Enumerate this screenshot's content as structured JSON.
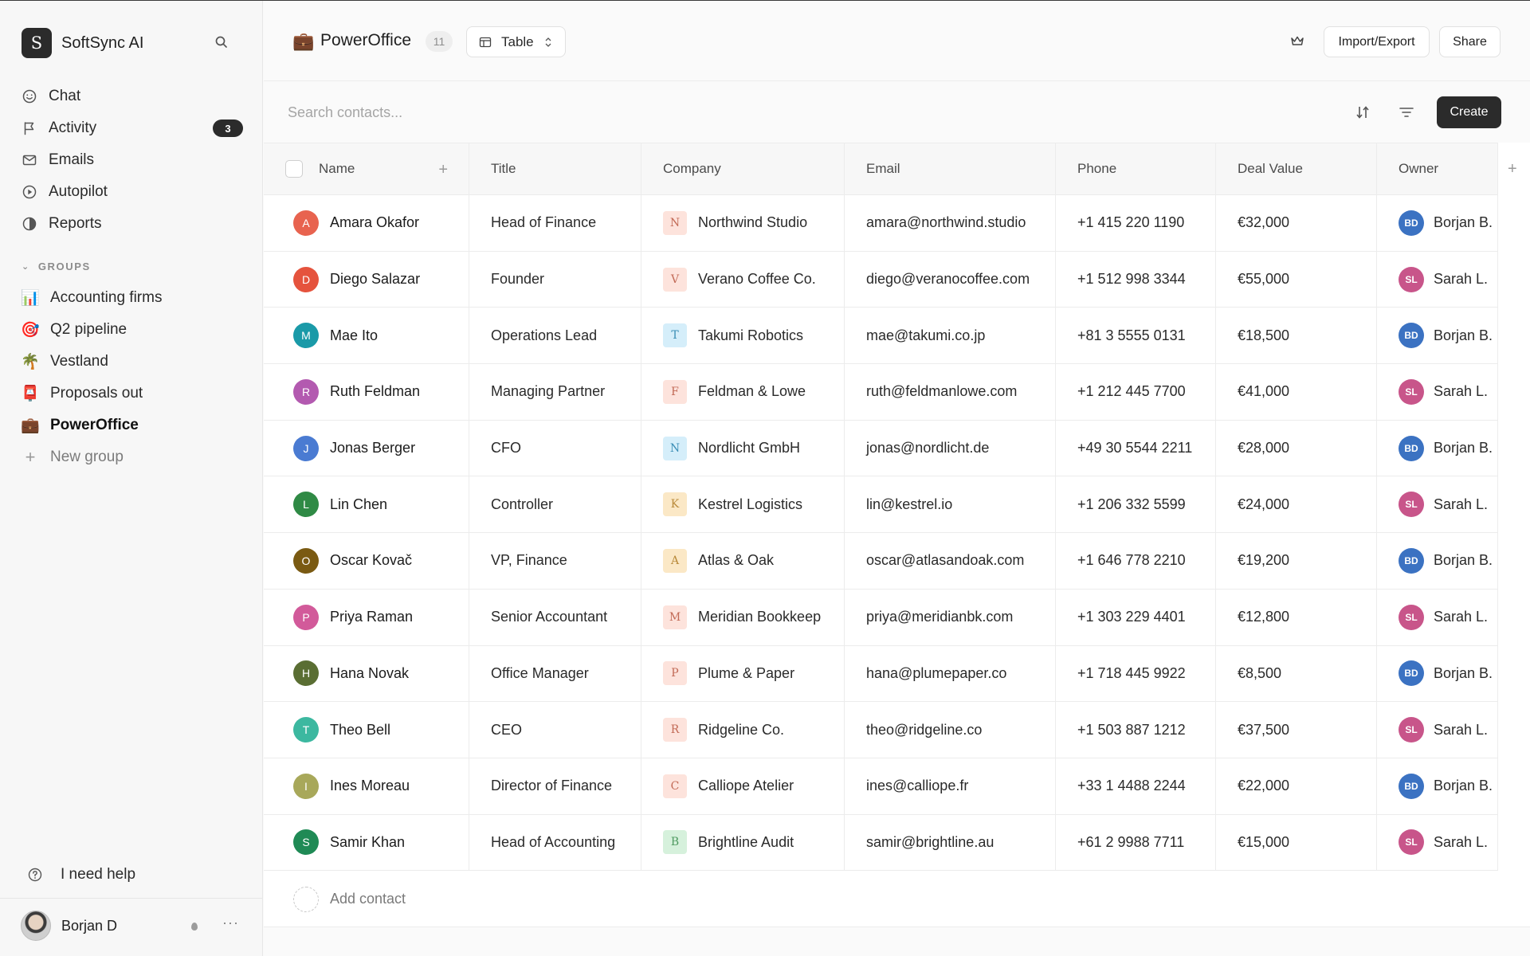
{
  "app": {
    "name": "SoftSync AI",
    "logo_letter": "S"
  },
  "sidebar": {
    "nav": [
      {
        "id": "chat",
        "label": "Chat",
        "icon": "smile-icon"
      },
      {
        "id": "activity",
        "label": "Activity",
        "icon": "flag-icon",
        "badge": "3"
      },
      {
        "id": "emails",
        "label": "Emails",
        "icon": "mail-icon"
      },
      {
        "id": "autopilot",
        "label": "Autopilot",
        "icon": "play-circle-icon"
      },
      {
        "id": "reports",
        "label": "Reports",
        "icon": "half-circle-icon"
      }
    ],
    "groups_heading": "GROUPS",
    "groups": [
      {
        "label": "Accounting firms",
        "emoji": "📊"
      },
      {
        "label": "Q2 pipeline",
        "emoji": "🎯"
      },
      {
        "label": "Vestland",
        "emoji": "🌴"
      },
      {
        "label": "Proposals out",
        "emoji": "📮"
      },
      {
        "label": "PowerOffice",
        "emoji": "💼",
        "active": true
      }
    ],
    "new_group_label": "New group",
    "help_label": "I need help",
    "user_name": "Borjan D",
    "more_label": "···"
  },
  "header": {
    "title": "PowerOffice",
    "emoji": "💼",
    "count": "11",
    "view_label": "Table",
    "import_export_label": "Import/Export",
    "share_label": "Share"
  },
  "toolbar": {
    "search_placeholder": "Search contacts...",
    "create_label": "Create"
  },
  "table": {
    "columns": [
      "Name",
      "Title",
      "Company",
      "Email",
      "Phone",
      "Deal Value",
      "Owner"
    ],
    "add_contact_label": "Add contact",
    "rows": [
      {
        "initial": "A",
        "avatar_color": "#e8634f",
        "name": "Amara Okafor",
        "title": "Head of Finance",
        "company": "Northwind Studio",
        "co_letter": "N",
        "co_bg": "#fde3dc",
        "co_fg": "#c26a56",
        "email": "amara@northwind.studio",
        "phone": "+1 415 220 1190",
        "deal": "€32,000",
        "owner_initials": "BD",
        "owner_color": "#3b72c2",
        "owner": "Borjan B."
      },
      {
        "initial": "D",
        "avatar_color": "#e5533d",
        "name": "Diego Salazar",
        "title": "Founder",
        "company": "Verano Coffee Co.",
        "co_letter": "V",
        "co_bg": "#fde3dc",
        "co_fg": "#c26a56",
        "email": "diego@veranocoffee.com",
        "phone": "+1 512 998 3344",
        "deal": "€55,000",
        "owner_initials": "SL",
        "owner_color": "#c8558a",
        "owner": "Sarah L."
      },
      {
        "initial": "M",
        "avatar_color": "#1a9aa8",
        "name": "Mae Ito",
        "title": "Operations Lead",
        "company": "Takumi Robotics",
        "co_letter": "T",
        "co_bg": "#d5eefa",
        "co_fg": "#3c8fb6",
        "email": "mae@takumi.co.jp",
        "phone": "+81 3 5555 0131",
        "deal": "€18,500",
        "owner_initials": "BD",
        "owner_color": "#3b72c2",
        "owner": "Borjan B."
      },
      {
        "initial": "R",
        "avatar_color": "#b35ab0",
        "name": "Ruth Feldman",
        "title": "Managing Partner",
        "company": "Feldman & Lowe",
        "co_letter": "F",
        "co_bg": "#fde3dc",
        "co_fg": "#c26a56",
        "email": "ruth@feldmanlowe.com",
        "phone": "+1 212 445 7700",
        "deal": "€41,000",
        "owner_initials": "SL",
        "owner_color": "#c8558a",
        "owner": "Sarah L."
      },
      {
        "initial": "J",
        "avatar_color": "#4a7bd2",
        "name": "Jonas Berger",
        "title": "CFO",
        "company": "Nordlicht GmbH",
        "co_letter": "N",
        "co_bg": "#d5eefa",
        "co_fg": "#3c8fb6",
        "email": "jonas@nordlicht.de",
        "phone": "+49 30 5544 2211",
        "deal": "€28,000",
        "owner_initials": "BD",
        "owner_color": "#3b72c2",
        "owner": "Borjan B."
      },
      {
        "initial": "L",
        "avatar_color": "#2f8a45",
        "name": "Lin Chen",
        "title": "Controller",
        "company": "Kestrel Logistics",
        "co_letter": "K",
        "co_bg": "#fbe8c6",
        "co_fg": "#b98a3a",
        "email": "lin@kestrel.io",
        "phone": "+1 206 332 5599",
        "deal": "€24,000",
        "owner_initials": "SL",
        "owner_color": "#c8558a",
        "owner": "Sarah L."
      },
      {
        "initial": "O",
        "avatar_color": "#7a5a12",
        "name": "Oscar Kovač",
        "title": "VP, Finance",
        "company": "Atlas & Oak",
        "co_letter": "A",
        "co_bg": "#fbe8c6",
        "co_fg": "#b98a3a",
        "email": "oscar@atlasandoak.com",
        "phone": "+1 646 778 2210",
        "deal": "€19,200",
        "owner_initials": "BD",
        "owner_color": "#3b72c2",
        "owner": "Borjan B."
      },
      {
        "initial": "P",
        "avatar_color": "#d25a9a",
        "name": "Priya Raman",
        "title": "Senior Accountant",
        "company": "Meridian Bookkeep",
        "co_letter": "M",
        "co_bg": "#fde3dc",
        "co_fg": "#c26a56",
        "email": "priya@meridianbk.com",
        "phone": "+1 303 229 4401",
        "deal": "€12,800",
        "owner_initials": "SL",
        "owner_color": "#c8558a",
        "owner": "Sarah L."
      },
      {
        "initial": "H",
        "avatar_color": "#5a6e33",
        "name": "Hana Novak",
        "title": "Office Manager",
        "company": "Plume & Paper",
        "co_letter": "P",
        "co_bg": "#fde3dc",
        "co_fg": "#c26a56",
        "email": "hana@plumepaper.co",
        "phone": "+1 718 445 9922",
        "deal": "€8,500",
        "owner_initials": "BD",
        "owner_color": "#3b72c2",
        "owner": "Borjan B."
      },
      {
        "initial": "T",
        "avatar_color": "#3cb8a0",
        "name": "Theo Bell",
        "title": "CEO",
        "company": "Ridgeline Co.",
        "co_letter": "R",
        "co_bg": "#fde3dc",
        "co_fg": "#c26a56",
        "email": "theo@ridgeline.co",
        "phone": "+1 503 887 1212",
        "deal": "€37,500",
        "owner_initials": "SL",
        "owner_color": "#c8558a",
        "owner": "Sarah L."
      },
      {
        "initial": "I",
        "avatar_color": "#a8a85a",
        "name": "Ines Moreau",
        "title": "Director of Finance",
        "company": "Calliope Atelier",
        "co_letter": "C",
        "co_bg": "#fde3dc",
        "co_fg": "#c26a56",
        "email": "ines@calliope.fr",
        "phone": "+33 1 4488 2244",
        "deal": "€22,000",
        "owner_initials": "BD",
        "owner_color": "#3b72c2",
        "owner": "Borjan B."
      },
      {
        "initial": "S",
        "avatar_color": "#1f8a55",
        "name": "Samir Khan",
        "title": "Head of Accounting",
        "company": "Brightline Audit",
        "co_letter": "B",
        "co_bg": "#d6f1dc",
        "co_fg": "#4f9a61",
        "email": "samir@brightline.au",
        "phone": "+61 2 9988 7711",
        "deal": "€15,000",
        "owner_initials": "SL",
        "owner_color": "#c8558a",
        "owner": "Sarah L."
      }
    ]
  }
}
